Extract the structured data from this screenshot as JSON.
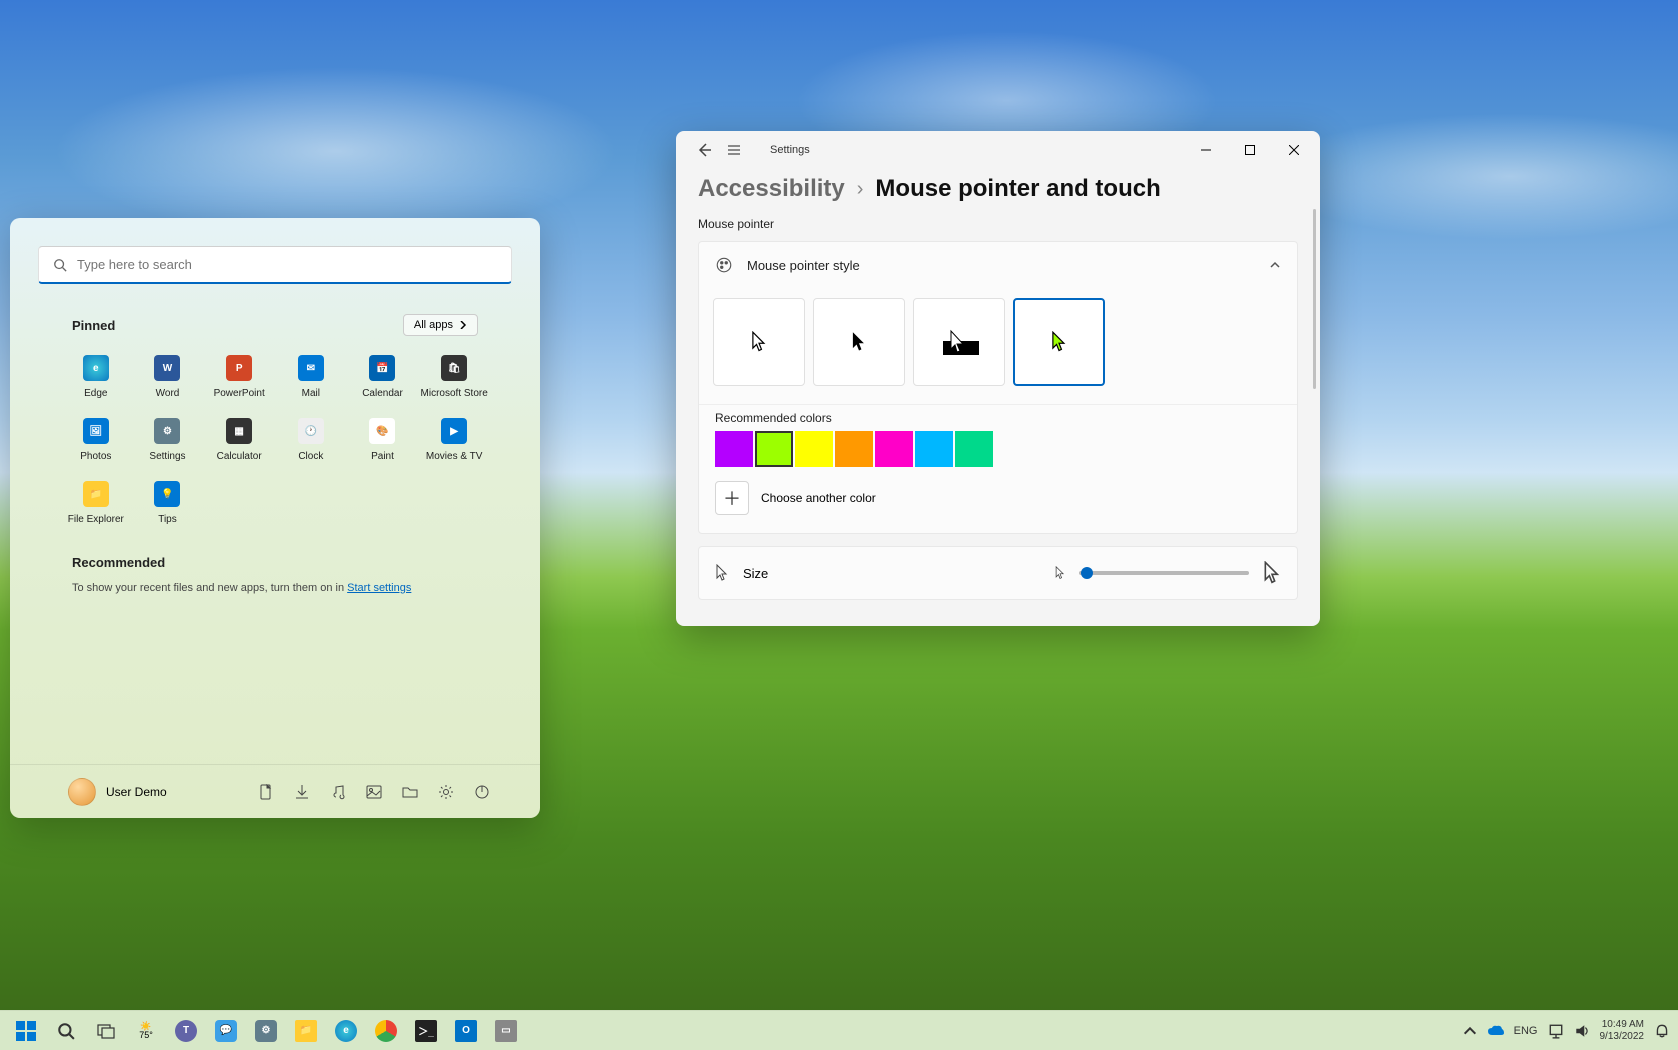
{
  "start_menu": {
    "search_placeholder": "Type here to search",
    "pinned_title": "Pinned",
    "all_apps_label": "All apps",
    "pinned": [
      {
        "label": "Edge"
      },
      {
        "label": "Word"
      },
      {
        "label": "PowerPoint"
      },
      {
        "label": "Mail"
      },
      {
        "label": "Calendar"
      },
      {
        "label": "Microsoft Store"
      },
      {
        "label": "Photos"
      },
      {
        "label": "Settings"
      },
      {
        "label": "Calculator"
      },
      {
        "label": "Clock"
      },
      {
        "label": "Paint"
      },
      {
        "label": "Movies & TV"
      },
      {
        "label": "File Explorer"
      },
      {
        "label": "Tips"
      }
    ],
    "recommended_title": "Recommended",
    "recommended_text_prefix": "To show your recent files and new apps, turn them on in ",
    "recommended_link": "Start settings",
    "user_name": "User Demo"
  },
  "settings": {
    "app_title": "Settings",
    "breadcrumb_parent": "Accessibility",
    "breadcrumb_current": "Mouse pointer and touch",
    "section_mouse_pointer": "Mouse pointer",
    "style_header": "Mouse pointer style",
    "style_selected_index": 3,
    "recommended_colors_label": "Recommended colors",
    "colors": [
      "#b400ff",
      "#9cff00",
      "#ffff00",
      "#ff9900",
      "#ff00c8",
      "#00b7ff",
      "#00d98b"
    ],
    "color_selected_index": 1,
    "choose_color_label": "Choose another color",
    "size_label": "Size",
    "size_value": 1
  },
  "taskbar": {
    "weather_temp": "75°",
    "tray_lang": "ENG",
    "clock_time": "10:49 AM",
    "clock_date": "9/13/2022"
  }
}
